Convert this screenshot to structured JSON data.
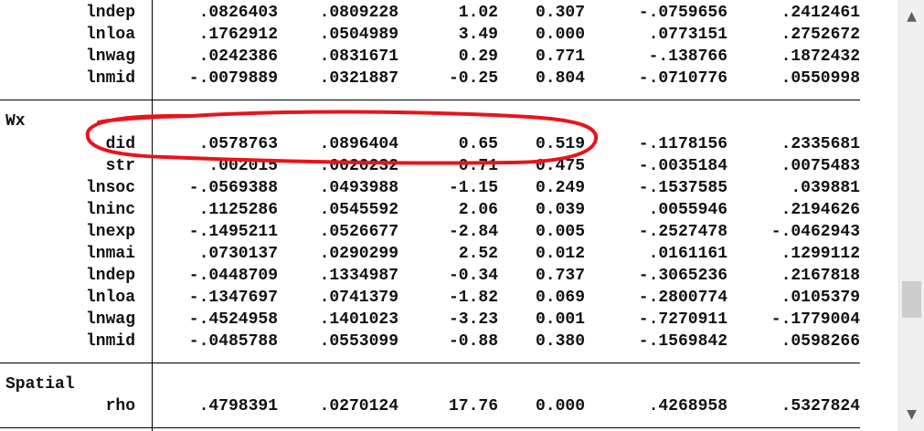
{
  "sections": {
    "wx_label": "Wx",
    "spatial_label": "Spatial"
  },
  "top_rows": [
    {
      "var": "lndep",
      "coef": ".0826403",
      "se": ".0809228",
      "z": "1.02",
      "p": "0.307",
      "lo": "-.0759656",
      "hi": ".2412461"
    },
    {
      "var": "lnloa",
      "coef": ".1762912",
      "se": ".0504989",
      "z": "3.49",
      "p": "0.000",
      "lo": ".0773151",
      "hi": ".2752672"
    },
    {
      "var": "lnwag",
      "coef": ".0242386",
      "se": ".0831671",
      "z": "0.29",
      "p": "0.771",
      "lo": "-.138766",
      "hi": ".1872432"
    },
    {
      "var": "lnmid",
      "coef": "-.0079889",
      "se": ".0321887",
      "z": "-0.25",
      "p": "0.804",
      "lo": "-.0710776",
      "hi": ".0550998"
    }
  ],
  "wx_rows": [
    {
      "var": "did",
      "coef": ".0578763",
      "se": ".0896404",
      "z": "0.65",
      "p": "0.519",
      "lo": "-.1178156",
      "hi": ".2335681"
    },
    {
      "var": "str",
      "coef": ".002015",
      "se": ".0020232",
      "z": "0.71",
      "p": "0.475",
      "lo": "-.0035184",
      "hi": ".0075483"
    },
    {
      "var": "lnsoc",
      "coef": "-.0569388",
      "se": ".0493988",
      "z": "-1.15",
      "p": "0.249",
      "lo": "-.1537585",
      "hi": ".039881"
    },
    {
      "var": "lninc",
      "coef": ".1125286",
      "se": ".0545592",
      "z": "2.06",
      "p": "0.039",
      "lo": ".0055946",
      "hi": ".2194626"
    },
    {
      "var": "lnexp",
      "coef": "-.1495211",
      "se": ".0526677",
      "z": "-2.84",
      "p": "0.005",
      "lo": "-.2527478",
      "hi": "-.0462943"
    },
    {
      "var": "lnmai",
      "coef": ".0730137",
      "se": ".0290299",
      "z": "2.52",
      "p": "0.012",
      "lo": ".0161161",
      "hi": ".1299112"
    },
    {
      "var": "lndep",
      "coef": "-.0448709",
      "se": ".1334987",
      "z": "-0.34",
      "p": "0.737",
      "lo": "-.3065236",
      "hi": ".2167818"
    },
    {
      "var": "lnloa",
      "coef": "-.1347697",
      "se": ".0741379",
      "z": "-1.82",
      "p": "0.069",
      "lo": "-.2800774",
      "hi": ".0105379"
    },
    {
      "var": "lnwag",
      "coef": "-.4524958",
      "se": ".1401023",
      "z": "-3.23",
      "p": "0.001",
      "lo": "-.7270911",
      "hi": "-.1779004"
    },
    {
      "var": "lnmid",
      "coef": "-.0485788",
      "se": ".0553099",
      "z": "-0.88",
      "p": "0.380",
      "lo": "-.1569842",
      "hi": ".0598266"
    }
  ],
  "spatial_rows": [
    {
      "var": "rho",
      "coef": ".4798391",
      "se": ".0270124",
      "z": "17.76",
      "p": "0.000",
      "lo": ".4268958",
      "hi": ".5327824"
    }
  ],
  "annotation_color": "#e8141b",
  "scrollbar": {
    "up_icon": "▲",
    "down_icon": "▼"
  }
}
